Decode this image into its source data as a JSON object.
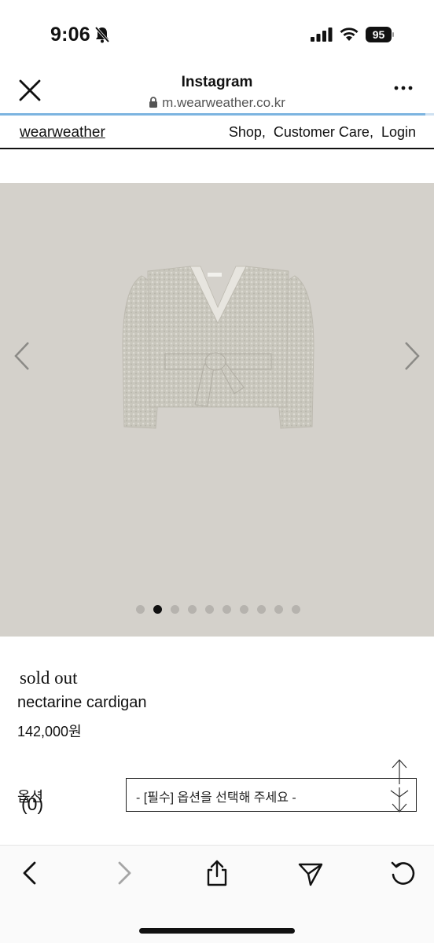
{
  "status_bar": {
    "time": "9:06",
    "battery": "95",
    "icons": [
      "bell-slash-icon",
      "signal-icon",
      "wifi-icon",
      "battery-icon"
    ]
  },
  "browser": {
    "title": "Instagram",
    "url": "m.wearweather.co.kr",
    "load_progress": 0.98
  },
  "site_nav": {
    "logo": "wearweather",
    "links": [
      "Shop,",
      "Customer Care,",
      "Login"
    ]
  },
  "gallery": {
    "image_count": 10,
    "active_index": 1,
    "background_color": "#d4d1cb"
  },
  "product": {
    "status": "sold out",
    "name": "nectarine cardigan",
    "price": "142,000원"
  },
  "option": {
    "label": "옵션",
    "count": "(0)",
    "select_placeholder": "- [필수] 옵션을 선택해 주세요 -"
  },
  "toolbar": {
    "icons": [
      "back-icon",
      "forward-icon",
      "share-icon",
      "send-icon",
      "reload-icon"
    ]
  }
}
